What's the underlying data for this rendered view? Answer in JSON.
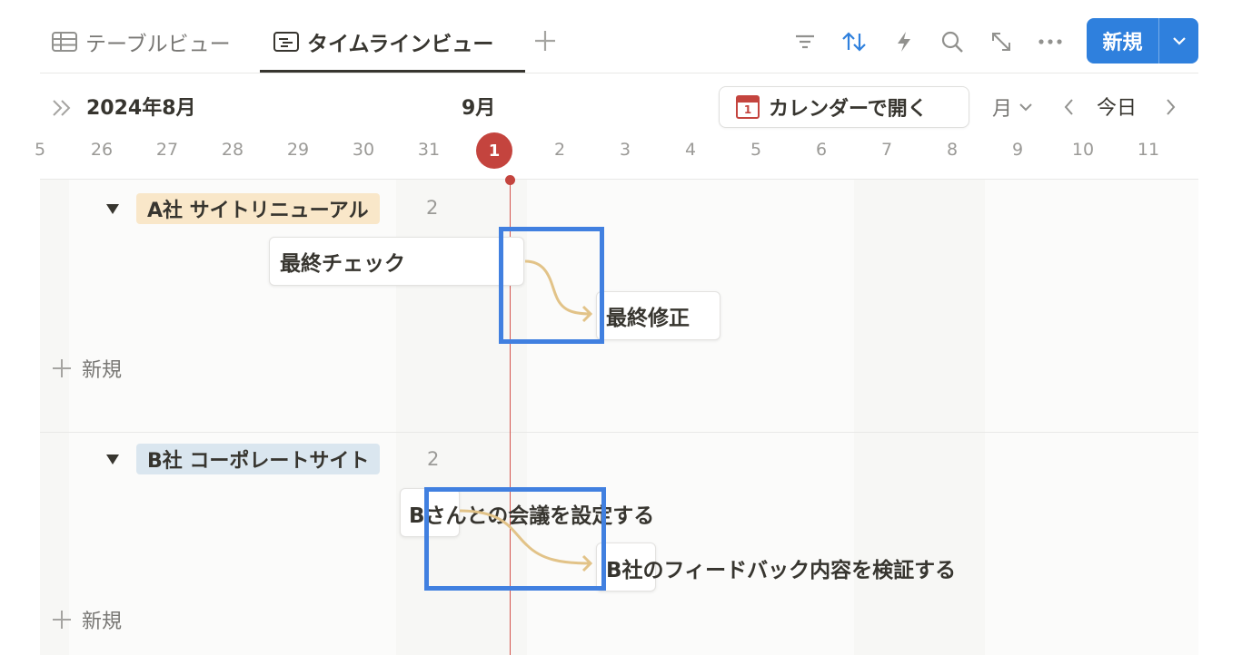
{
  "tabs": {
    "table_label": "テーブルビュー",
    "timeline_label": "タイムラインビュー"
  },
  "toolbar": {
    "icons": [
      "filter-icon",
      "sort-icon",
      "automation-icon",
      "search-icon",
      "expand-icon",
      "more-icon"
    ],
    "new_label": "新規"
  },
  "timeline": {
    "month_left": "2024年8月",
    "month_current": "9月",
    "open_calendar_label": "カレンダーで開く",
    "calendar_icon_day": "1",
    "period_label": "月",
    "today_label": "今日",
    "days": [
      "5",
      "26",
      "27",
      "28",
      "29",
      "30",
      "31",
      "1",
      "2",
      "3",
      "4",
      "5",
      "6",
      "7",
      "8",
      "9",
      "10",
      "11"
    ],
    "today_day": "1"
  },
  "groups": [
    {
      "name": "A社 サイトリニューアル",
      "count": "2",
      "tasks": [
        "最終チェック",
        "最終修正"
      ],
      "add_label": "新規"
    },
    {
      "name": "B社 コーポレートサイト",
      "count": "2",
      "tasks": [
        "Bさんとの会議を設定する",
        "B社のフィードバック内容を検証する"
      ],
      "add_label": "新規"
    }
  ],
  "colors": {
    "accent": "#2f80dd",
    "today": "#c4443e",
    "dependency": "#e2c388",
    "highlight": "#4180e0",
    "group_a_tag": "#f9e7c9",
    "group_b_tag": "#dae6ef"
  }
}
